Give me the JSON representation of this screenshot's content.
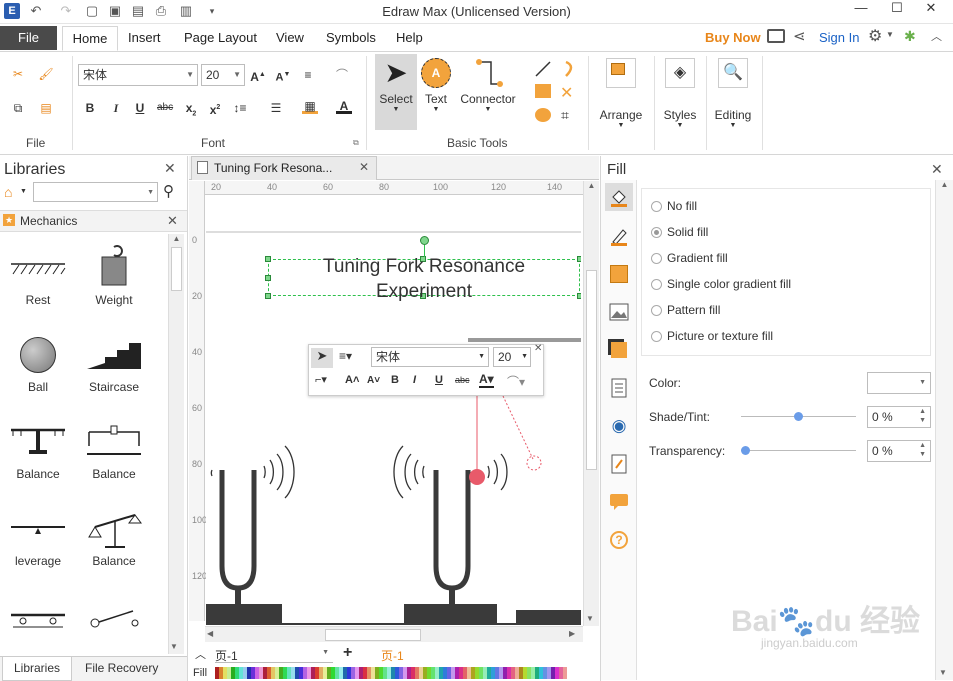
{
  "app": {
    "title": "Edraw Max (Unlicensed Version)"
  },
  "menu": {
    "file": "File",
    "tabs": [
      "Home",
      "Insert",
      "Page Layout",
      "View",
      "Symbols",
      "Help"
    ],
    "buy_now": "Buy Now",
    "sign_in": "Sign In"
  },
  "ribbon": {
    "groups": {
      "file": "File",
      "font": "Font",
      "basic_tools": "Basic Tools"
    },
    "font_name": "宋体",
    "font_size": "20",
    "select": "Select",
    "text": "Text",
    "connector": "Connector",
    "arrange": "Arrange",
    "styles": "Styles",
    "editing": "Editing"
  },
  "libraries": {
    "title": "Libraries",
    "category": "Mechanics",
    "items": [
      "Rest",
      "Weight",
      "Ball",
      "Staircase",
      "Balance",
      "Balance",
      "leverage",
      "Balance"
    ],
    "bottom_tabs": [
      "Libraries",
      "File Recovery"
    ]
  },
  "document": {
    "tab_title": "Tuning Fork Resona...",
    "ruler_h": [
      "20",
      "40",
      "60",
      "80",
      "100",
      "120",
      "140"
    ],
    "ruler_v": [
      "0",
      "20",
      "40",
      "60",
      "80",
      "100",
      "120"
    ],
    "canvas_title_line1": "Tuning Fork Resonance",
    "canvas_title_line2": "Experiment",
    "mini_font": "宋体",
    "mini_size": "20",
    "page_select": "页-1",
    "page_tab": "页-1",
    "fill_label": "Fill"
  },
  "fill": {
    "title": "Fill",
    "options": [
      "No fill",
      "Solid fill",
      "Gradient fill",
      "Single color gradient fill",
      "Pattern fill",
      "Picture or texture fill"
    ],
    "selected": 1,
    "color_label": "Color:",
    "shade_label": "Shade/Tint:",
    "shade_value": "0 %",
    "transparency_label": "Transparency:",
    "transparency_value": "0 %"
  },
  "colors": {
    "accent": "#e8861a",
    "fork": "#3a3a3a",
    "ball": "#e85a6a",
    "selection": "#2ec04c"
  }
}
